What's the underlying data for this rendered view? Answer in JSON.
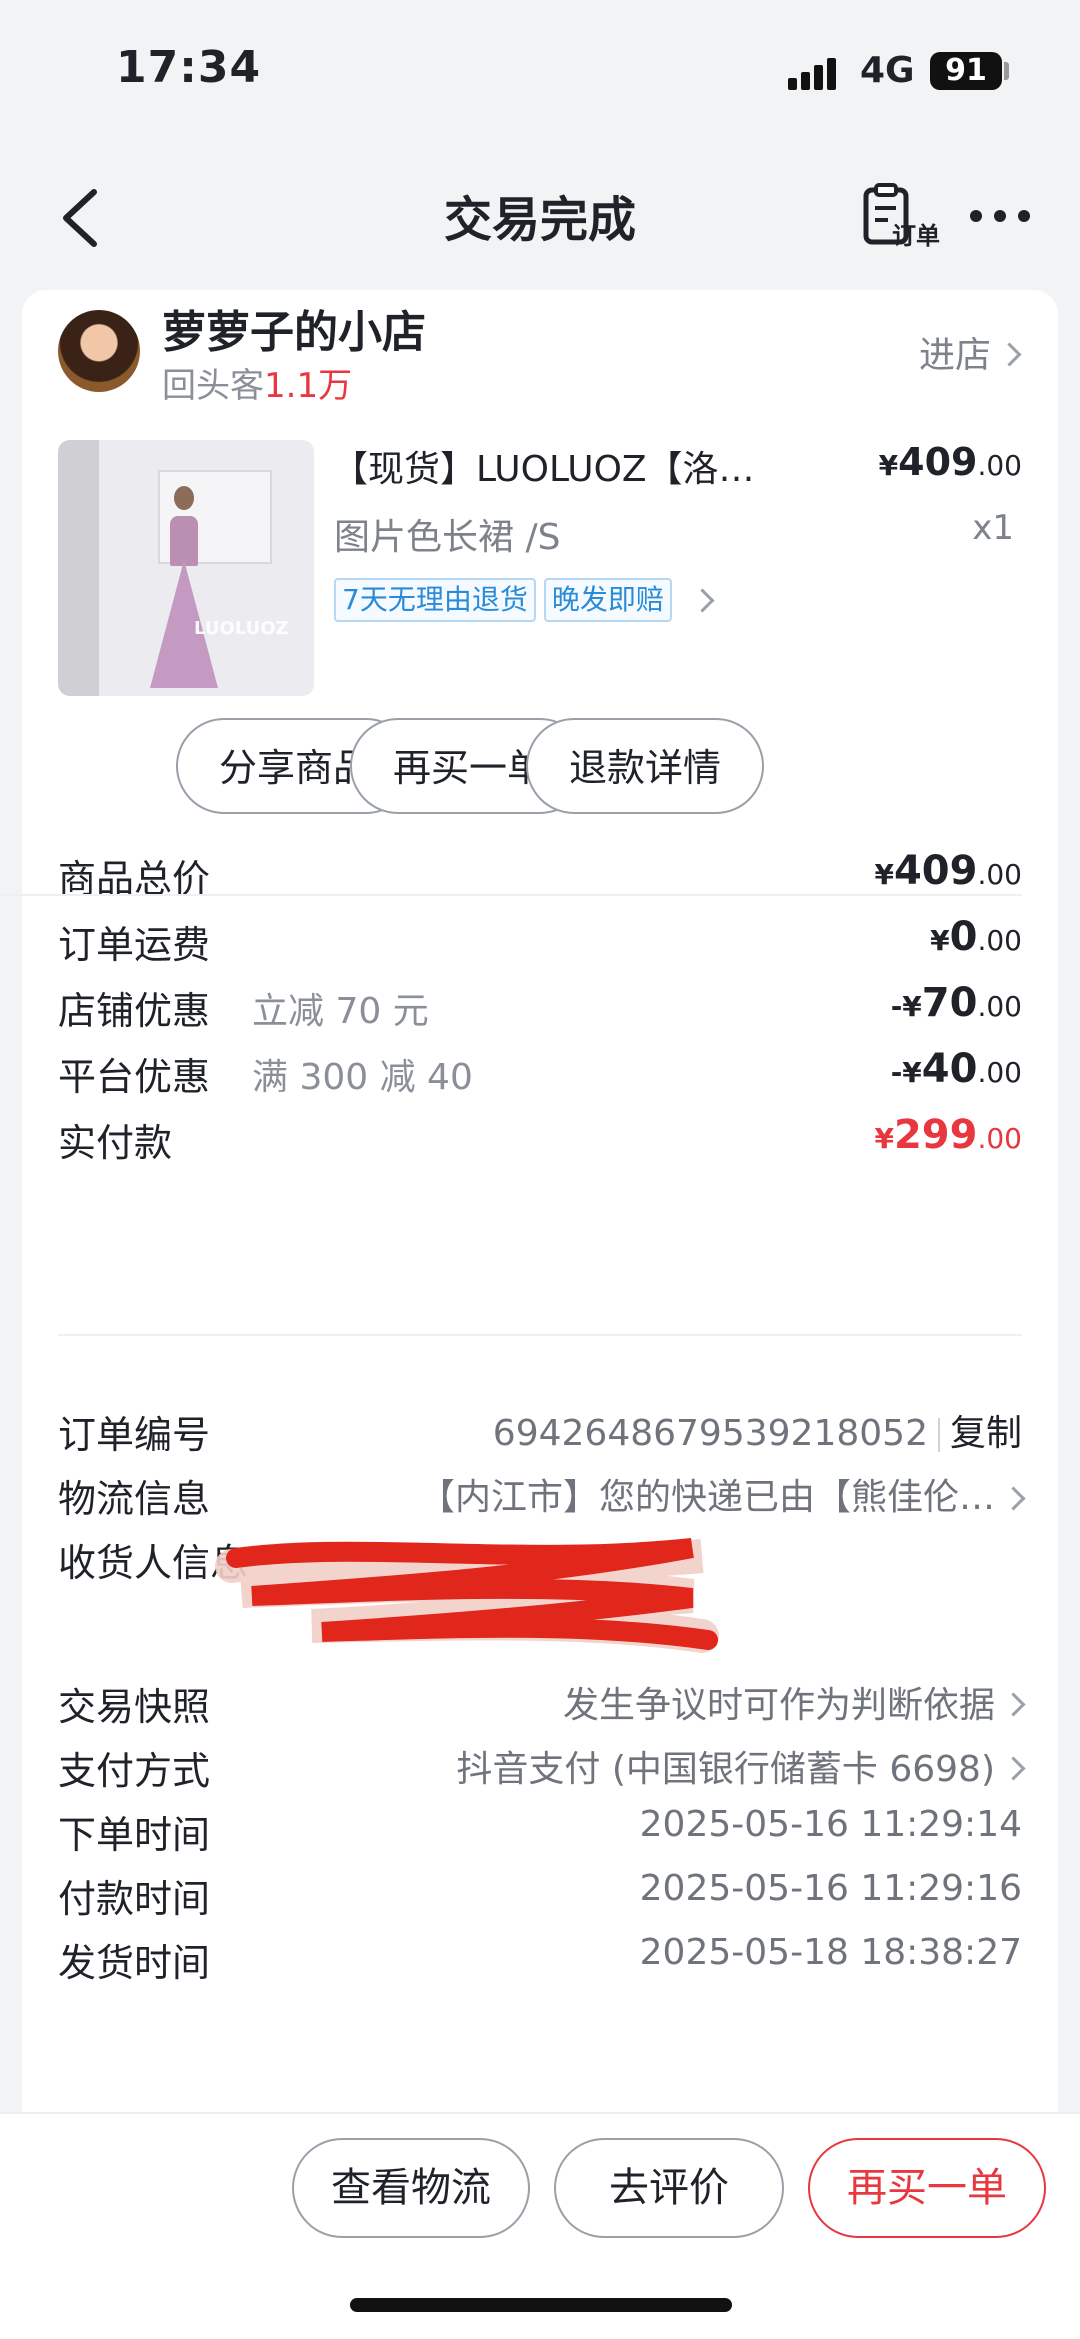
{
  "status_bar": {
    "time": "17:34",
    "network": "4G",
    "battery": "91"
  },
  "header": {
    "title": "交易完成",
    "order_label": "订单"
  },
  "shop": {
    "name": "萝萝子的小店",
    "sub_label": "回头客",
    "sub_value": "1.1万",
    "enter_label": "进店"
  },
  "product": {
    "title": "【现货】LUOLUOZ【洛…",
    "price_int": "409",
    "price_dec": ".00",
    "currency": "¥",
    "spec": "图片色长裙 /S",
    "qty": "x1",
    "image_brand": "LUOLUOZ",
    "tags": [
      "7天无理由退货",
      "晚发即赔"
    ]
  },
  "actions": [
    "分享商品",
    "再买一单",
    "退款详情"
  ],
  "summary": [
    {
      "label": "商品总价",
      "note": "",
      "prefix": "¥",
      "int": "409",
      "dec": ".00"
    },
    {
      "label": "订单运费",
      "note": "",
      "prefix": "¥",
      "int": "0",
      "dec": ".00"
    },
    {
      "label": "店铺优惠",
      "note": "立减 70 元",
      "prefix": "-¥",
      "int": "70",
      "dec": ".00"
    },
    {
      "label": "平台优惠",
      "note": "满 300 减 40",
      "prefix": "-¥",
      "int": "40",
      "dec": ".00"
    },
    {
      "label": "实付款",
      "note": "",
      "prefix": "¥",
      "int": "299",
      "dec": ".00"
    }
  ],
  "details": {
    "order_no": {
      "label": "订单编号",
      "value": "6942648679539218052",
      "copy": "复制"
    },
    "logistics": {
      "label": "物流信息",
      "value": "【内江市】您的快递已由【熊佳伦…"
    },
    "receiver": {
      "label": "收货人信息"
    },
    "snapshot": {
      "label": "交易快照",
      "value": "发生争议时可作为判断依据"
    },
    "payment": {
      "label": "支付方式",
      "value": "抖音支付 (中国银行储蓄卡 6698)"
    },
    "order_time": {
      "label": "下单时间",
      "value": "2025-05-16 11:29:14"
    },
    "pay_time": {
      "label": "付款时间",
      "value": "2025-05-16 11:29:16"
    },
    "ship_time": {
      "label": "发货时间",
      "value": "2025-05-18 18:38:27"
    }
  },
  "bottom_actions": [
    "查看物流",
    "去评价",
    "再买一单"
  ],
  "colors": {
    "accent": "#e8373f",
    "tag_blue": "#2a8bd6",
    "background": "#f2f3f5"
  }
}
